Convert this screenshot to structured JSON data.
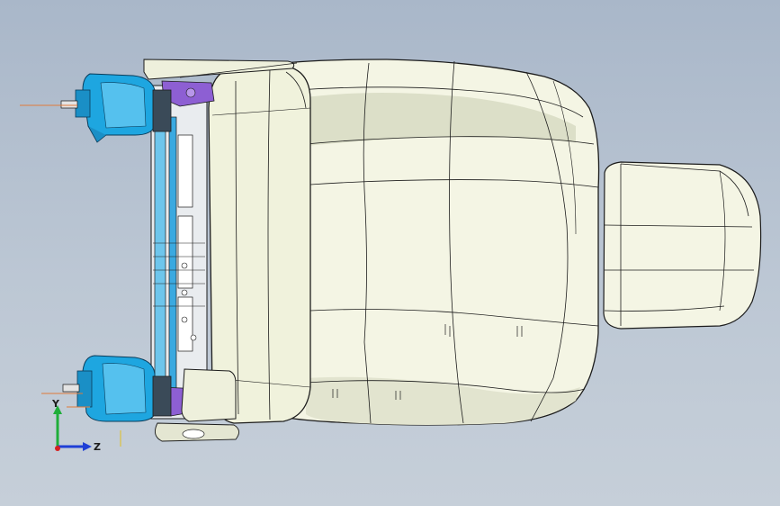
{
  "viewport": {
    "background_top": "#a9b7c9",
    "background_bottom": "#c6cfd9"
  },
  "model": {
    "shell_color": "#f4f5e4",
    "shell_shade": "#d9dcc4",
    "outline_color": "#1c1c1c",
    "motor_color": "#1ea6e0",
    "motor_shade": "#0a6fa6",
    "frame_color": "#6ec6ec",
    "bracket_color": "#8d5fd3",
    "shaft_color": "#e07a3a"
  },
  "triad": {
    "x_label": "",
    "y_label": "Y",
    "z_label": "Z",
    "y_color": "#1fae3a",
    "z_color": "#1f3fd6",
    "x_color": "#d62020"
  }
}
